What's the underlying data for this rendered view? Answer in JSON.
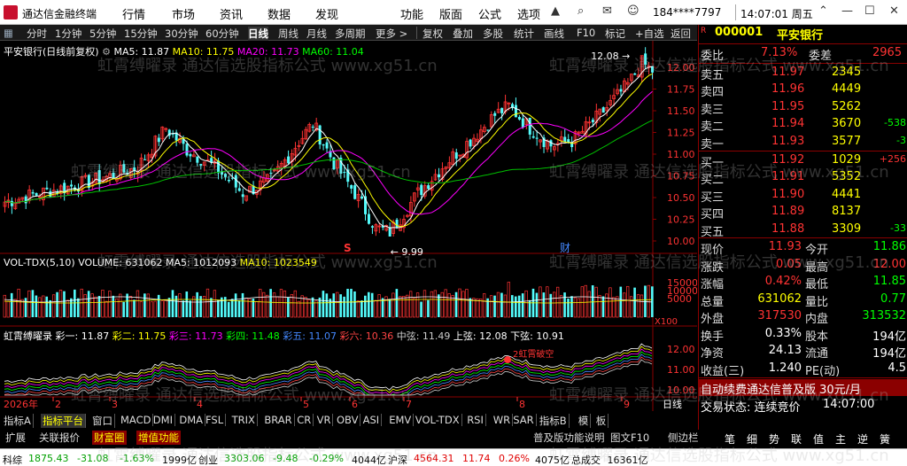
{
  "window": {
    "title": "通达信金融终端",
    "menus": [
      "行情",
      "市场",
      "资讯",
      "数据",
      "发现",
      "功能",
      "版面",
      "公式",
      "选项"
    ],
    "user": "184****7797",
    "clock": "14:07:01 周五"
  },
  "toolbar": {
    "items": [
      "分时",
      "1分钟",
      "5分钟",
      "15分钟",
      "30分钟",
      "60分钟",
      "日线",
      "周线",
      "月线",
      "多周期",
      "更多 >",
      "复权",
      "叠加",
      "多股",
      "统计",
      "画线",
      "F10",
      "标记",
      "+自选",
      "返回"
    ],
    "active": "日线"
  },
  "main_chart": {
    "header": {
      "title": "平安银行(日线前复权)",
      "indicators": [
        {
          "label": "MA5: 11.87",
          "color": "#ffffff"
        },
        {
          "label": "MA10: 11.75",
          "color": "#ffff00"
        },
        {
          "label": "MA20: 11.73",
          "color": "#ff00ff"
        },
        {
          "label": "MA60: 11.04",
          "color": "#00ff00"
        }
      ]
    },
    "price_ticks": [
      "12.00",
      "11.75",
      "11.50",
      "11.25",
      "11.00",
      "10.75",
      "10.50",
      "10.25",
      "10.00"
    ],
    "high_label": "12.08",
    "low_label": "9.99",
    "marker_s": "S",
    "marker_cai": "财"
  },
  "vol_chart": {
    "header": [
      {
        "label": "VOL-TDX(5,10)",
        "color": "#ffffff"
      },
      {
        "label": "VOLUME: 631062",
        "color": "#ffffff"
      },
      {
        "label": "MA5: 1012093",
        "color": "#ffffff"
      },
      {
        "label": "MA10: 1023549",
        "color": "#ffff00"
      }
    ],
    "ticks": [
      "15000",
      "10000",
      "5000"
    ],
    "unit": "X100"
  },
  "ind_chart": {
    "header": [
      {
        "label": "虹霄缚曜录",
        "color": "#ffffff"
      },
      {
        "label": "彩一: 11.87",
        "color": "#ffffff"
      },
      {
        "label": "彩二: 11.75",
        "color": "#ffff00"
      },
      {
        "label": "彩三: 11.73",
        "color": "#ff00ff"
      },
      {
        "label": "彩四: 11.48",
        "color": "#00ff00"
      },
      {
        "label": "彩五: 11.07",
        "color": "#4488ff"
      },
      {
        "label": "彩六: 10.36",
        "color": "#ff4444"
      },
      {
        "label": "中弦: 11.49",
        "color": "#cccccc"
      },
      {
        "label": "上弦: 12.08",
        "color": "#ffffff"
      },
      {
        "label": "下弦: 10.91",
        "color": "#ffffff"
      }
    ],
    "ticks": [
      "12.00",
      "11.00",
      "10.00"
    ],
    "annotation": "2虹霄破空"
  },
  "time_axis": {
    "year": "2026年",
    "months": [
      "2",
      "3",
      "4",
      "5",
      "6",
      "7",
      "8",
      "9"
    ],
    "period": "日线"
  },
  "bottom_tabs": {
    "row1": [
      "指标A",
      "指标平台",
      "窗口",
      "MACD",
      "DMI",
      "DMA",
      "FSL",
      "TRIX",
      "BRAR",
      "CR",
      "VR",
      "OBV",
      "ASI",
      "EMV",
      "VOL-TDX",
      "RSI",
      "WR",
      "SAR",
      "指标B",
      "模",
      "板"
    ],
    "row1_active": "指标平台",
    "row2": [
      "扩展",
      "关联报价",
      "财富圈",
      "增值功能"
    ],
    "row2_right": [
      "普及版功能说明",
      "图文F10",
      "侧边栏"
    ]
  },
  "quote": {
    "code": "000001",
    "name": "平安银行",
    "weibi_label": "委比",
    "weibi": "7.13%",
    "weicha_label": "委差",
    "weicha": "2965",
    "sell": [
      {
        "label": "卖五",
        "price": "11.97",
        "vol": "2345",
        "chg": ""
      },
      {
        "label": "卖四",
        "price": "11.96",
        "vol": "4449",
        "chg": ""
      },
      {
        "label": "卖三",
        "price": "11.95",
        "vol": "5262",
        "chg": ""
      },
      {
        "label": "卖二",
        "price": "11.94",
        "vol": "3670",
        "chg": "-538"
      },
      {
        "label": "卖一",
        "price": "11.93",
        "vol": "3577",
        "chg": "-3"
      }
    ],
    "buy": [
      {
        "label": "买一",
        "price": "11.92",
        "vol": "1029",
        "chg": "+256"
      },
      {
        "label": "买二",
        "price": "11.91",
        "vol": "5352",
        "chg": ""
      },
      {
        "label": "买三",
        "price": "11.90",
        "vol": "4441",
        "chg": ""
      },
      {
        "label": "买四",
        "price": "11.89",
        "vol": "8137",
        "chg": ""
      },
      {
        "label": "买五",
        "price": "11.88",
        "vol": "3309",
        "chg": "-33"
      }
    ],
    "stats": [
      {
        "l1": "现价",
        "v1": "11.93",
        "c1": "#ff3333",
        "l2": "今开",
        "v2": "11.86",
        "c2": "#00ff00"
      },
      {
        "l1": "涨跌",
        "v1": "0.05",
        "c1": "#ff3333",
        "l2": "最高",
        "v2": "12.00",
        "c2": "#ff3333"
      },
      {
        "l1": "涨幅",
        "v1": "0.42%",
        "c1": "#ff3333",
        "l2": "最低",
        "v2": "11.85",
        "c2": "#00ff00"
      },
      {
        "l1": "总量",
        "v1": "631062",
        "c1": "#ffff00",
        "l2": "量比",
        "v2": "0.77",
        "c2": "#00ff00"
      },
      {
        "l1": "外盘",
        "v1": "317530",
        "c1": "#ff3333",
        "l2": "内盘",
        "v2": "313532",
        "c2": "#00ff00"
      },
      {
        "l1": "换手",
        "v1": "0.33%",
        "c1": "#ffffff",
        "l2": "股本",
        "v2": "194亿",
        "c2": "#ffffff"
      },
      {
        "l1": "净资",
        "v1": "24.13",
        "c1": "#ffffff",
        "l2": "流通",
        "v2": "194亿",
        "c2": "#ffffff"
      },
      {
        "l1": "收益(三)",
        "v1": "1.240",
        "c1": "#ffffff",
        "l2": "PE(动)",
        "v2": "4.5",
        "c2": "#ffffff"
      }
    ],
    "promo": "自动续费通达信普及版 30元/月",
    "trade_status_label": "交易状态: 连续竞价",
    "trade_status_time": "14:07:00",
    "buttons": [
      "笔",
      "细",
      "势",
      "联",
      "值",
      "主",
      "逆",
      "簧"
    ]
  },
  "status_bar": [
    {
      "text": "科综",
      "color": "#000000"
    },
    {
      "text": "1875.43",
      "color": "#00a000"
    },
    {
      "text": "-31.08",
      "color": "#00a000"
    },
    {
      "text": "-1.63%",
      "color": "#00a000"
    },
    {
      "text": "1999亿",
      "color": "#000000"
    },
    {
      "text": "创业",
      "color": "#000000"
    },
    {
      "text": "3303.06",
      "color": "#00a000"
    },
    {
      "text": "-9.48",
      "color": "#00a000"
    },
    {
      "text": "-0.29%",
      "color": "#00a000"
    },
    {
      "text": "4044亿",
      "color": "#000000"
    },
    {
      "text": "沪深",
      "color": "#000000"
    },
    {
      "text": "4564.31",
      "color": "#e00000"
    },
    {
      "text": "11.74",
      "color": "#e00000"
    },
    {
      "text": "0.26%",
      "color": "#e00000"
    },
    {
      "text": "4075亿",
      "color": "#000000"
    },
    {
      "text": "总成交",
      "color": "#000000"
    },
    {
      "text": "16361亿",
      "color": "#000000"
    }
  ],
  "watermark": "虹霄缚曜录 通达信选股指标公式 www.xg51.cn"
}
